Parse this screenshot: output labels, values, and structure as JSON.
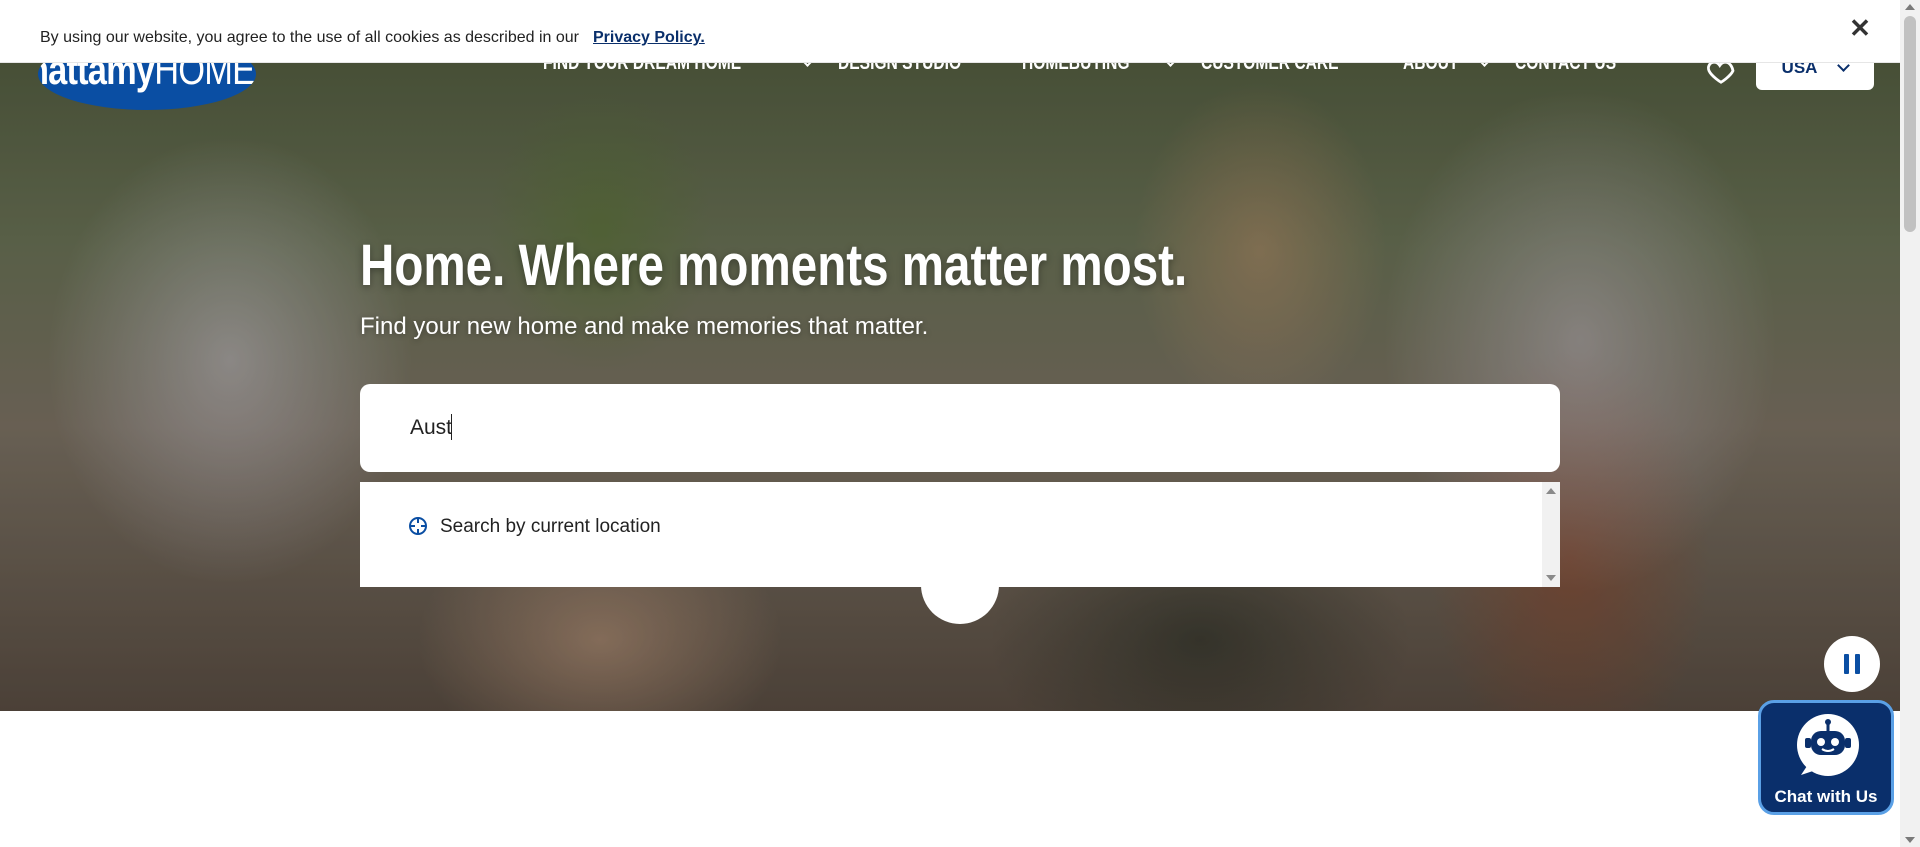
{
  "cookie_bar": {
    "text": "By using our website, you agree to the use of all cookies as described in our",
    "link": "Privacy Policy.",
    "close_symbol": "✕"
  },
  "brand": {
    "logo_bold": "mattamy",
    "logo_light": "HOMES",
    "color": "#0a4ea3"
  },
  "nav": {
    "items": [
      {
        "label": "FIND YOUR DREAM HOME",
        "has_dropdown": true
      },
      {
        "label": "DESIGN STUDIO",
        "has_dropdown": false
      },
      {
        "label": "HOMEBUYING",
        "has_dropdown": true
      },
      {
        "label": "CUSTOMER CARE",
        "has_dropdown": false
      },
      {
        "label": "ABOUT",
        "has_dropdown": true
      },
      {
        "label": "CONTACT US",
        "has_dropdown": false
      }
    ],
    "country": "USA"
  },
  "hero": {
    "headline": "Home. Where moments matter most.",
    "subhead": "Find your new home and make memories that matter.",
    "search_value": "Aust"
  },
  "dropdown": {
    "current_location": "Search by current location"
  },
  "chat": {
    "label": "Chat with Us"
  },
  "colors": {
    "navy": "#0a2f6b",
    "accent": "#0a4ea3",
    "chat_border": "#5aa0e6"
  }
}
